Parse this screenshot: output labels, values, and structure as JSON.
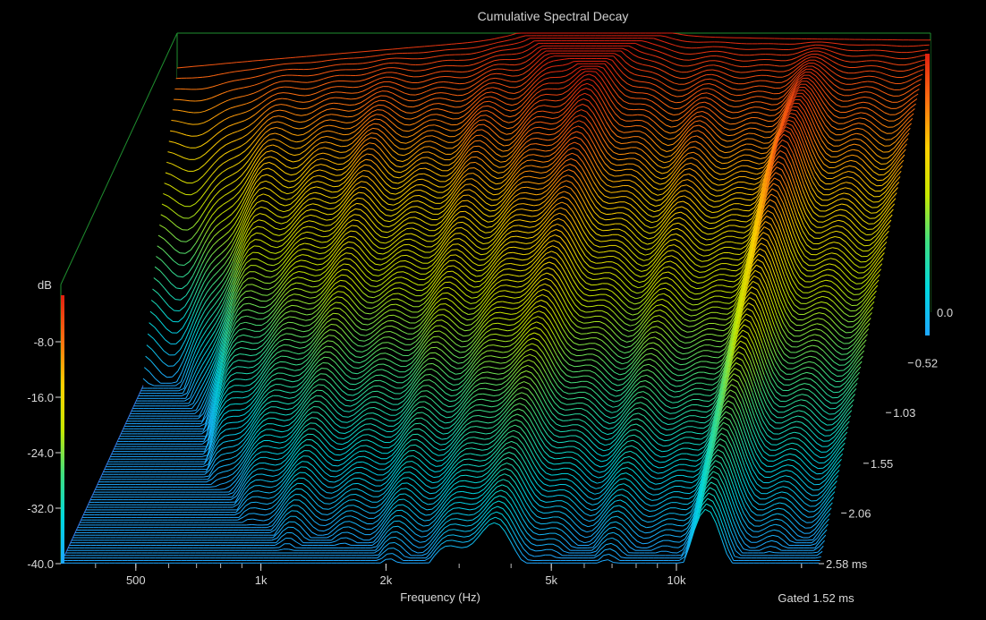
{
  "chart_data": {
    "type": "waterfall",
    "title": "Cumulative Spectral Decay",
    "xlabel": "Frequency (Hz)",
    "ylabel": "dB",
    "gated_note": "Gated 1.52 ms",
    "x_scale": "log",
    "xlim": [
      330,
      22000
    ],
    "ylim": [
      -40,
      0
    ],
    "zlim": [
      0,
      2.58
    ],
    "x_tick_values": [
      500,
      1000,
      2000,
      5000,
      10000
    ],
    "x_tick_labels": [
      "500",
      "1k",
      "2k",
      "5k",
      "10k"
    ],
    "y_tick_values": [
      -8,
      -16,
      -24,
      -32,
      -40
    ],
    "y_tick_labels": [
      "-8.0",
      "-16.0",
      "-24.0",
      "-32.0",
      "-40.0"
    ],
    "right_axis_label": "0.0",
    "time_tick_labels": [
      "0.52",
      "1.03",
      "1.55",
      "2.06",
      "2.58 ms"
    ],
    "time_tick_values": [
      0.52,
      1.03,
      1.55,
      2.06,
      2.58
    ],
    "colorbar_colors": [
      "#1ea7ff",
      "#00d8e0",
      "#40e080",
      "#c8e800",
      "#ffd000",
      "#ff7010",
      "#e02010"
    ],
    "slices": {
      "count": 100,
      "time_step_ms": 0.026,
      "initial_response_db": [
        {
          "f": 330,
          "db": -5
        },
        {
          "f": 500,
          "db": -4
        },
        {
          "f": 1000,
          "db": -2.5
        },
        {
          "f": 2000,
          "db": -1
        },
        {
          "f": 5000,
          "db": -0.5
        },
        {
          "f": 10000,
          "db": -0.8
        },
        {
          "f": 20000,
          "db": -1
        }
      ]
    }
  }
}
